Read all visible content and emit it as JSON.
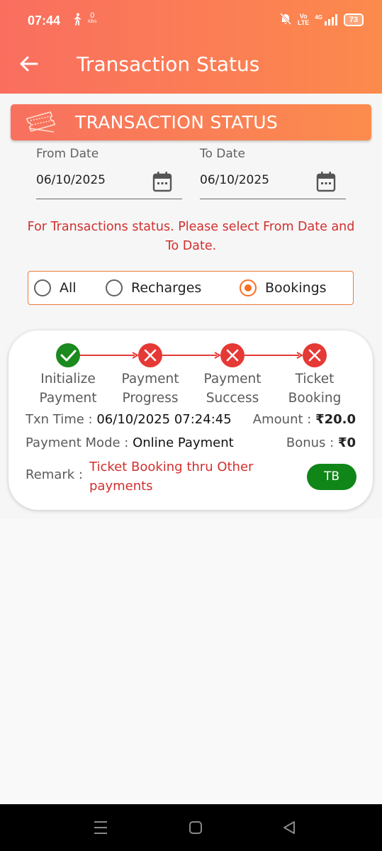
{
  "status_bar": {
    "time": "07:44",
    "net_speed_value": "0",
    "net_speed_unit": "KB/s",
    "volte": "Vo",
    "volte_sub": "LTE",
    "network": "4G",
    "battery": "73"
  },
  "app_bar": {
    "title": "Transaction Status"
  },
  "banner": {
    "title": "TRANSACTION STATUS"
  },
  "filters": {
    "from_label": "From Date",
    "from_value": "06/10/2025",
    "to_label": "To Date",
    "to_value": "06/10/2025",
    "hint": "For Transactions status. Please select From Date and To Date."
  },
  "radio": {
    "options": [
      {
        "label": "All",
        "selected": false
      },
      {
        "label": "Recharges",
        "selected": false
      },
      {
        "label": "Bookings",
        "selected": true
      }
    ]
  },
  "transaction": {
    "steps": [
      {
        "line1": "Initialize",
        "line2": "Payment",
        "status": "success"
      },
      {
        "line1": "Payment",
        "line2": "Progress",
        "status": "failed"
      },
      {
        "line1": "Payment",
        "line2": "Success",
        "status": "failed"
      },
      {
        "line1": "Ticket",
        "line2": "Booking",
        "status": "failed"
      }
    ],
    "txn_time_label": "Txn Time :",
    "txn_time_value": "06/10/2025 07:24:45",
    "amount_label": "Amount :",
    "amount_value": "₹20.0",
    "payment_mode_label": "Payment Mode :",
    "payment_mode_value": "Online Payment",
    "bonus_label": "Bonus :",
    "bonus_value": "₹0",
    "remark_label": "Remark :",
    "remark_value": "Ticket Booking thru Other payments",
    "badge": "TB",
    "colors": {
      "success": "#1b8a1f",
      "failed": "#e53935",
      "connector": "#e53935"
    }
  }
}
